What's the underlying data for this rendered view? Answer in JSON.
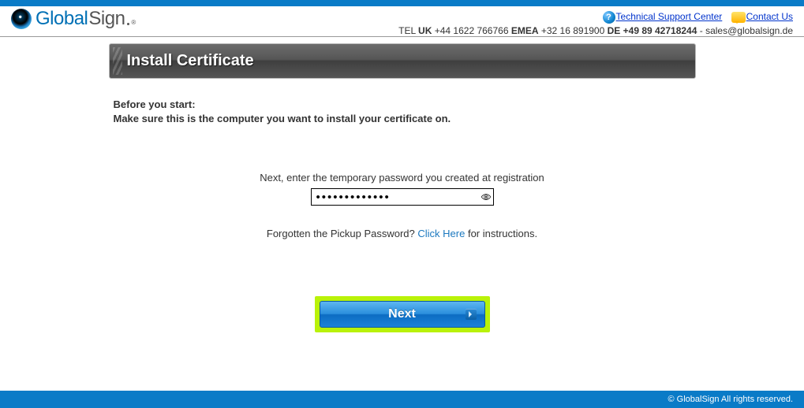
{
  "logo": {
    "global": "Global",
    "sign": "Sign"
  },
  "header": {
    "support_link": "Technical Support Center",
    "contact_link": "Contact Us",
    "tel_label": "TEL",
    "uk_label": "UK",
    "uk_num": "+44 1622 766766",
    "emea_label": "EMEA",
    "emea_num": "+32 16 891900",
    "de_label": "DE",
    "de_num": "+49 89 42718244",
    "sep": " - ",
    "email": "sales@globalsign.de"
  },
  "title": "Install Certificate",
  "intro": {
    "line1": "Before you start:",
    "line2": "Make sure this is the computer you want to install your certificate on."
  },
  "form": {
    "hint": "Next, enter the temporary password you created at registration",
    "value": "•••••••••••••",
    "forgot_pre": "Forgotten the Pickup Password? ",
    "forgot_link": "Click Here",
    "forgot_post": " for instructions."
  },
  "next_label": "Next",
  "footer": "© GlobalSign All rights reserved."
}
